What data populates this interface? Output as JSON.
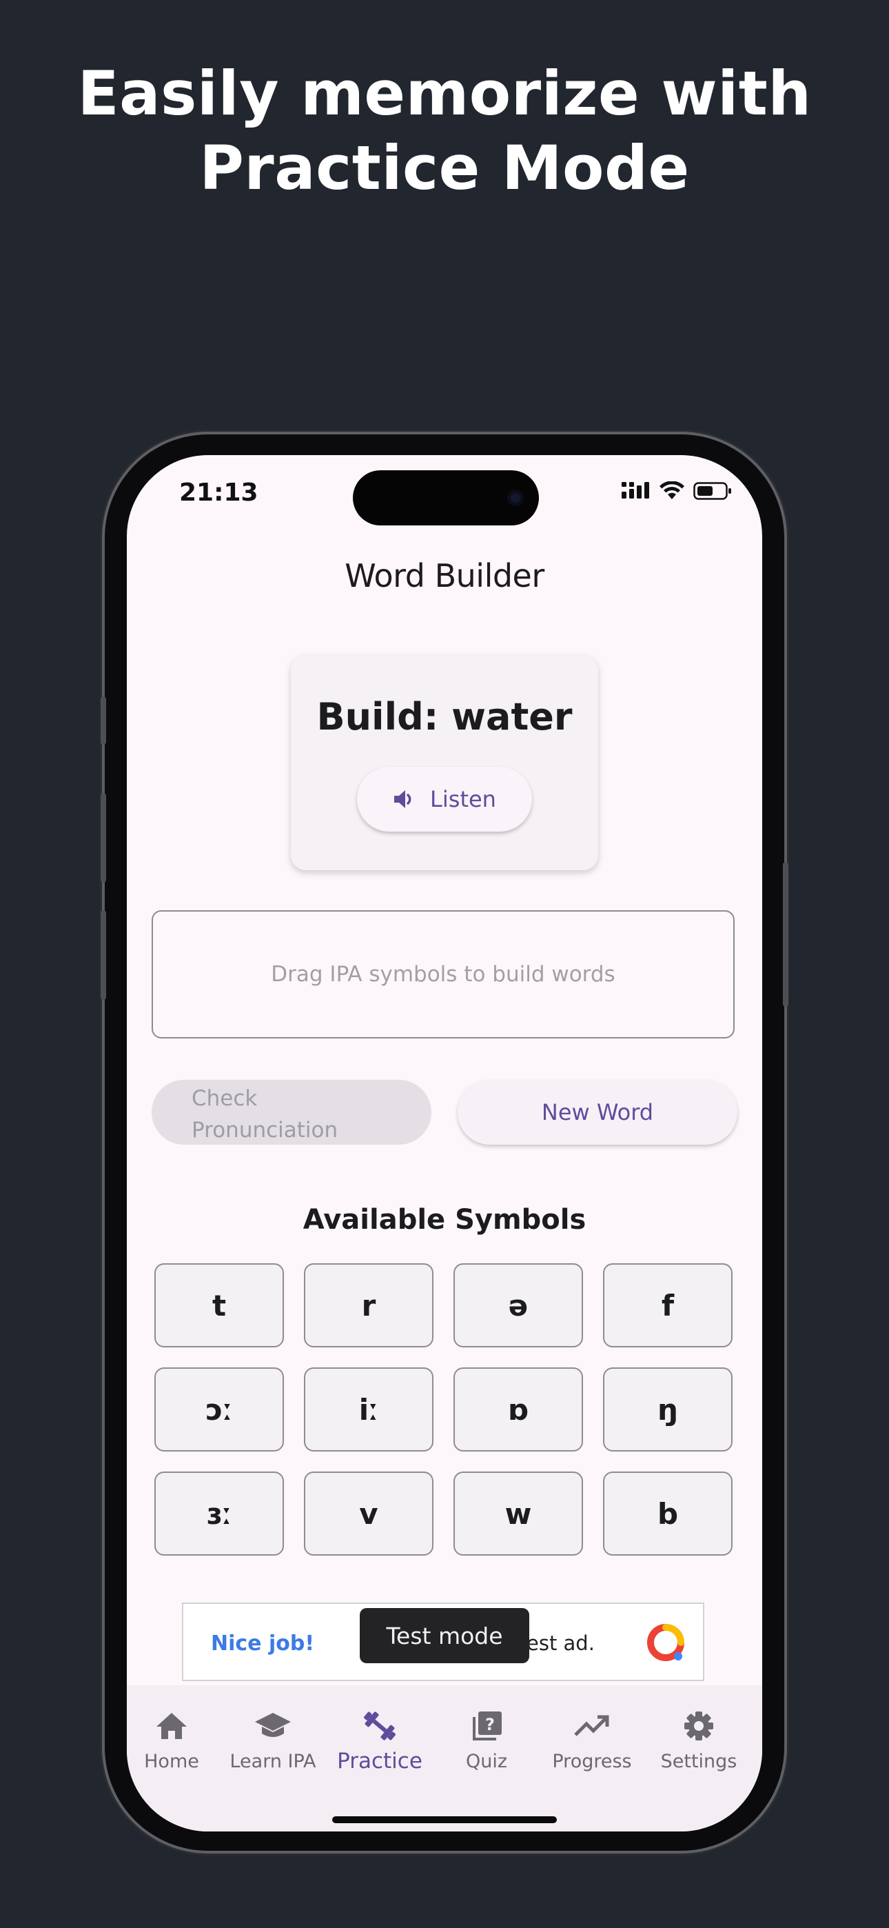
{
  "headline": {
    "line1": "Easily memorize with",
    "line2": "Practice Mode"
  },
  "status_bar": {
    "time": "21:13"
  },
  "app": {
    "title": "Word Builder"
  },
  "word_card": {
    "target": "Build: water",
    "listen_label": "Listen"
  },
  "drop_zone": {
    "placeholder": "Drag IPA symbols to build words"
  },
  "actions": {
    "check_line1": "Check",
    "check_line2": "Pronunciation",
    "new_word": "New Word"
  },
  "symbols": {
    "title": "Available Symbols",
    "items": [
      "t",
      "r",
      "ə",
      "f",
      "ɔː",
      "iː",
      "ɒ",
      "ŋ",
      "ɜː",
      "v",
      "w",
      "b"
    ]
  },
  "ad": {
    "left_text": "Nice job!",
    "right_text": "est ad.",
    "toast": "Test mode"
  },
  "nav": {
    "items": [
      {
        "label": "Home",
        "icon": "home-icon"
      },
      {
        "label": "Learn IPA",
        "icon": "school-icon"
      },
      {
        "label": "Practice",
        "icon": "fitness-icon"
      },
      {
        "label": "Quiz",
        "icon": "quiz-icon"
      },
      {
        "label": "Progress",
        "icon": "trending-up-icon"
      },
      {
        "label": "Settings",
        "icon": "gear-icon"
      }
    ],
    "active": "Practice"
  },
  "colors": {
    "accent": "#5f4c9c",
    "background": "#22262e",
    "screen": "#fdf7fc"
  }
}
